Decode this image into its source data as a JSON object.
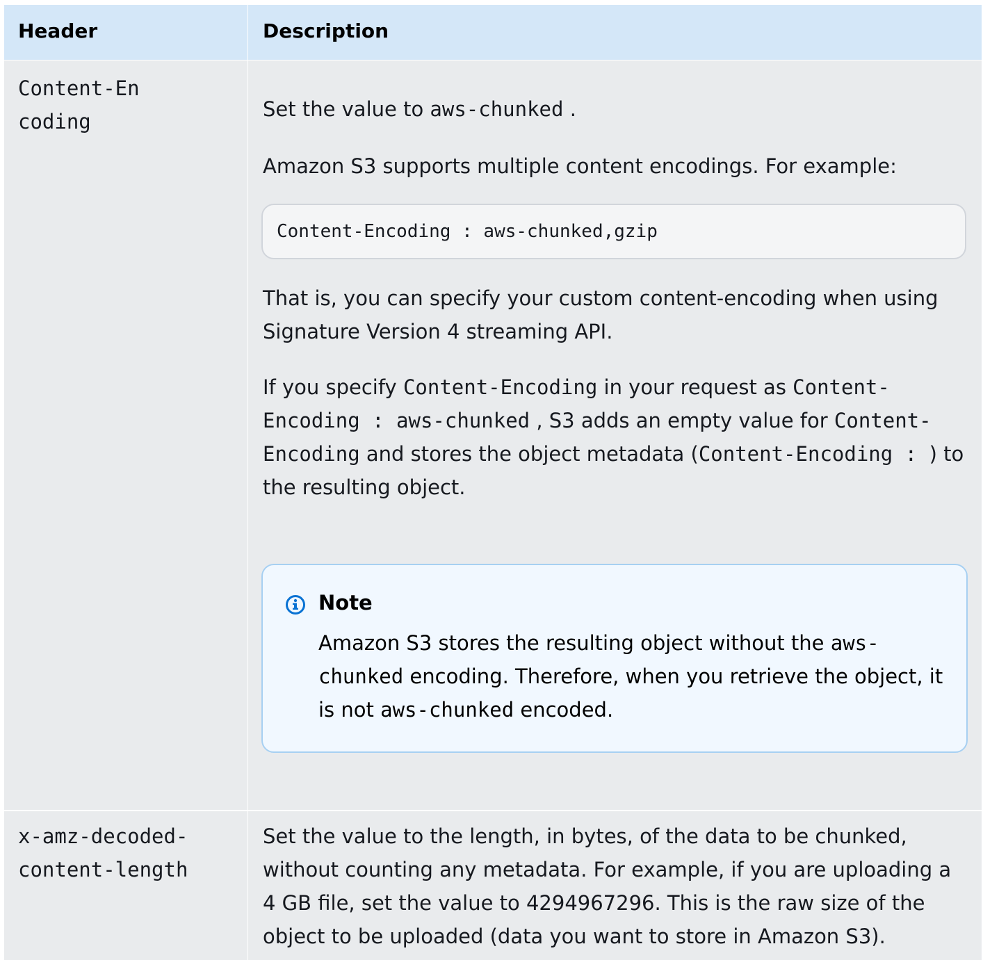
{
  "table": {
    "headers": {
      "header": "Header",
      "description": "Description"
    },
    "rows": [
      {
        "header": "Content-Encoding",
        "p1": {
          "before": "Set the value to ",
          "code": "aws-chunked",
          "after": " ."
        },
        "p2": "Amazon S3 supports multiple content encodings. For  example:",
        "code_example": "Content-Encoding : aws-chunked,gzip",
        "p3": " That is, you can specify your custom content-encoding when  using Signature Version 4 streaming API.",
        "p4": {
          "t1": "If you specify ",
          "c1": "Content-Encoding",
          "t2": "  in your request as ",
          "c2": "Content-Encoding : aws-chunked",
          "t3": " , S3 adds an empty value for ",
          "c3": "Content-Encoding",
          "t4": "  and stores the object metadata (",
          "c4": "Content-Encoding : ",
          "t5": " ) to the resulting object."
        },
        "note": {
          "title": "Note",
          "t1": "Amazon S3 stores the resulting object without the ",
          "c1": "aws-chunked",
          "t2": "  encoding. Therefore, when  you retrieve the object, it is not ",
          "c2": "aws-chunked",
          "t3": "  encoded."
        }
      },
      {
        "header": "x-amz-decoded-content-length",
        "description": "Set the value to the length, in bytes, of the data to be  chunked, without counting any metadata. For example, if you are  uploading a 4 GB file, set the value to 4294967296. This is the  raw size of the object to be uploaded (data you want to store in  Amazon S3)."
      }
    ]
  },
  "colors": {
    "header_bg": "#d4e7f8",
    "row_bg": "#e9ebed",
    "note_bg": "#f1f8ff",
    "note_border": "#a7d0f2",
    "info_icon": "#0972d3"
  },
  "icons": {
    "note": "info-icon"
  }
}
